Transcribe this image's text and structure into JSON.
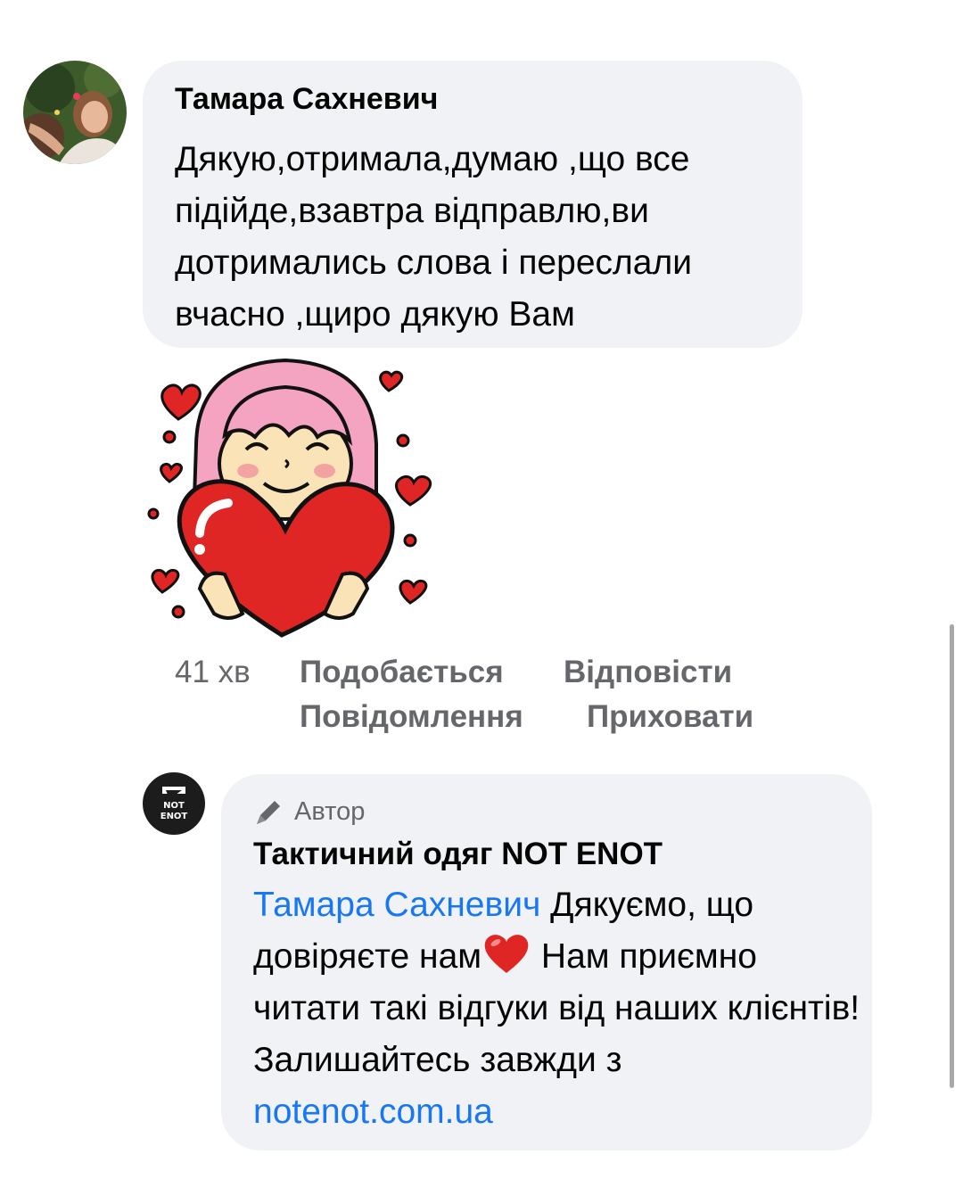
{
  "comment": {
    "author": "Тамара Сахневич",
    "text": "Дякую,отримала,думаю ,що все підійде,взавтра відправлю,ви дотримались слова і переслали вчасно ,щиро дякую Вам",
    "sticker": "girl-holding-heart-sticker",
    "time": "41 хв",
    "actions": {
      "like": "Подобається",
      "reply": "Відповісти",
      "message": "Повідомлення",
      "hide": "Приховати"
    }
  },
  "reply": {
    "badge_icon": "pen-icon",
    "badge_label": "Автор",
    "page_name": "Тактичний одяг NOT ENOT",
    "mention": "Тамара Сахневич",
    "text_1": " Дякуємо, що довіряєте нам",
    "emoji": "red-heart-emoji",
    "text_2": "  Нам приємно читати такі відгуки від наших клієнтів! Залишайтесь завжди з ",
    "link": "notenot.com.ua",
    "avatar_logo_text": "NOT ENOT"
  },
  "colors": {
    "bubble": "#f0f2f5",
    "secondary_text": "#65676b",
    "link": "#1877f2",
    "heart": "#e02525"
  }
}
